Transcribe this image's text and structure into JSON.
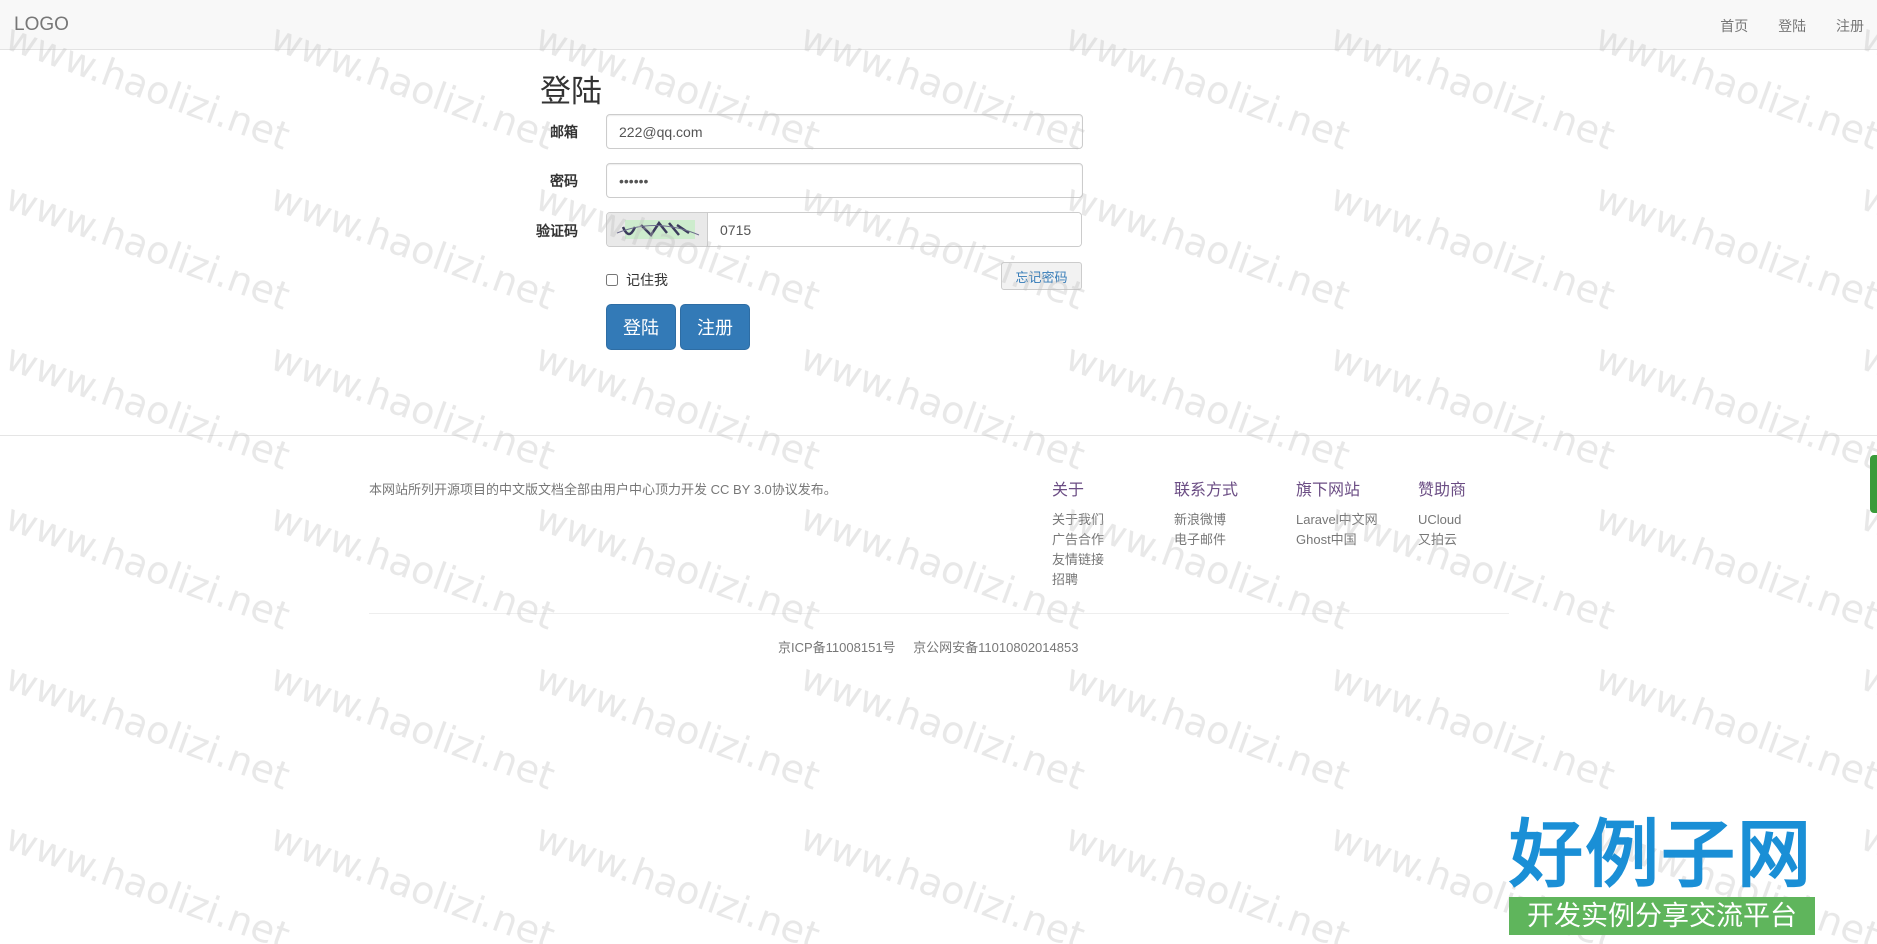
{
  "navbar": {
    "brand": "LOGO",
    "links": [
      "首页",
      "登陆",
      "注册"
    ]
  },
  "login": {
    "title": "登陆",
    "email_label": "邮箱",
    "email_value": "222@qq.com",
    "password_label": "密码",
    "password_value": "123456",
    "captcha_label": "验证码",
    "captcha_value": "0715",
    "remember_label": "记住我",
    "forgot_label": "忘记密码",
    "login_button": "登陆",
    "register_button": "注册"
  },
  "footer": {
    "description": "本网站所列开源项目的中文版文档全部由用户中心顶力开发 CC BY 3.0协议发布。",
    "columns": [
      {
        "title": "关于",
        "items": [
          "关于我们",
          "广告合作",
          "友情链接",
          "招聘"
        ]
      },
      {
        "title": "联系方式",
        "items": [
          "新浪微博",
          "电子邮件"
        ]
      },
      {
        "title": "旗下网站",
        "items": [
          "Laravel中文网",
          "Ghost中国"
        ]
      },
      {
        "title": "赞助商",
        "items": [
          "UCloud",
          "又拍云"
        ]
      }
    ],
    "icp": "京ICP备11008151号",
    "police": "京公网安备11010802014853"
  },
  "watermark": "www.haolizi.net",
  "site_logo": {
    "main": "好例子网",
    "sub": "开发实例分享交流平台"
  },
  "colors": {
    "primary": "#337ab7",
    "footer_title": "#6b4d84",
    "logo_blue": "#1a8fd6",
    "logo_green": "#5fb55c"
  }
}
